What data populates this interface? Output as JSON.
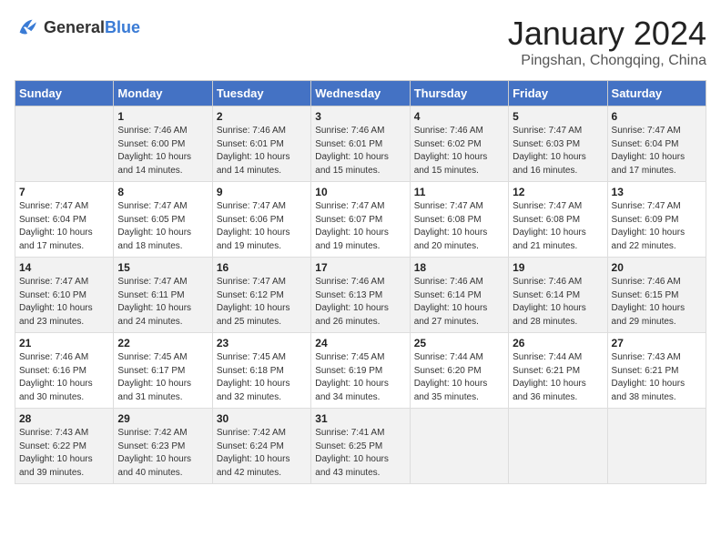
{
  "header": {
    "logo_general": "General",
    "logo_blue": "Blue",
    "month_title": "January 2024",
    "location": "Pingshan, Chongqing, China"
  },
  "days_of_week": [
    "Sunday",
    "Monday",
    "Tuesday",
    "Wednesday",
    "Thursday",
    "Friday",
    "Saturday"
  ],
  "weeks": [
    [
      {
        "day": "",
        "info": ""
      },
      {
        "day": "1",
        "info": "Sunrise: 7:46 AM\nSunset: 6:00 PM\nDaylight: 10 hours\nand 14 minutes."
      },
      {
        "day": "2",
        "info": "Sunrise: 7:46 AM\nSunset: 6:01 PM\nDaylight: 10 hours\nand 14 minutes."
      },
      {
        "day": "3",
        "info": "Sunrise: 7:46 AM\nSunset: 6:01 PM\nDaylight: 10 hours\nand 15 minutes."
      },
      {
        "day": "4",
        "info": "Sunrise: 7:46 AM\nSunset: 6:02 PM\nDaylight: 10 hours\nand 15 minutes."
      },
      {
        "day": "5",
        "info": "Sunrise: 7:47 AM\nSunset: 6:03 PM\nDaylight: 10 hours\nand 16 minutes."
      },
      {
        "day": "6",
        "info": "Sunrise: 7:47 AM\nSunset: 6:04 PM\nDaylight: 10 hours\nand 17 minutes."
      }
    ],
    [
      {
        "day": "7",
        "info": "Sunrise: 7:47 AM\nSunset: 6:04 PM\nDaylight: 10 hours\nand 17 minutes."
      },
      {
        "day": "8",
        "info": "Sunrise: 7:47 AM\nSunset: 6:05 PM\nDaylight: 10 hours\nand 18 minutes."
      },
      {
        "day": "9",
        "info": "Sunrise: 7:47 AM\nSunset: 6:06 PM\nDaylight: 10 hours\nand 19 minutes."
      },
      {
        "day": "10",
        "info": "Sunrise: 7:47 AM\nSunset: 6:07 PM\nDaylight: 10 hours\nand 19 minutes."
      },
      {
        "day": "11",
        "info": "Sunrise: 7:47 AM\nSunset: 6:08 PM\nDaylight: 10 hours\nand 20 minutes."
      },
      {
        "day": "12",
        "info": "Sunrise: 7:47 AM\nSunset: 6:08 PM\nDaylight: 10 hours\nand 21 minutes."
      },
      {
        "day": "13",
        "info": "Sunrise: 7:47 AM\nSunset: 6:09 PM\nDaylight: 10 hours\nand 22 minutes."
      }
    ],
    [
      {
        "day": "14",
        "info": "Sunrise: 7:47 AM\nSunset: 6:10 PM\nDaylight: 10 hours\nand 23 minutes."
      },
      {
        "day": "15",
        "info": "Sunrise: 7:47 AM\nSunset: 6:11 PM\nDaylight: 10 hours\nand 24 minutes."
      },
      {
        "day": "16",
        "info": "Sunrise: 7:47 AM\nSunset: 6:12 PM\nDaylight: 10 hours\nand 25 minutes."
      },
      {
        "day": "17",
        "info": "Sunrise: 7:46 AM\nSunset: 6:13 PM\nDaylight: 10 hours\nand 26 minutes."
      },
      {
        "day": "18",
        "info": "Sunrise: 7:46 AM\nSunset: 6:14 PM\nDaylight: 10 hours\nand 27 minutes."
      },
      {
        "day": "19",
        "info": "Sunrise: 7:46 AM\nSunset: 6:14 PM\nDaylight: 10 hours\nand 28 minutes."
      },
      {
        "day": "20",
        "info": "Sunrise: 7:46 AM\nSunset: 6:15 PM\nDaylight: 10 hours\nand 29 minutes."
      }
    ],
    [
      {
        "day": "21",
        "info": "Sunrise: 7:46 AM\nSunset: 6:16 PM\nDaylight: 10 hours\nand 30 minutes."
      },
      {
        "day": "22",
        "info": "Sunrise: 7:45 AM\nSunset: 6:17 PM\nDaylight: 10 hours\nand 31 minutes."
      },
      {
        "day": "23",
        "info": "Sunrise: 7:45 AM\nSunset: 6:18 PM\nDaylight: 10 hours\nand 32 minutes."
      },
      {
        "day": "24",
        "info": "Sunrise: 7:45 AM\nSunset: 6:19 PM\nDaylight: 10 hours\nand 34 minutes."
      },
      {
        "day": "25",
        "info": "Sunrise: 7:44 AM\nSunset: 6:20 PM\nDaylight: 10 hours\nand 35 minutes."
      },
      {
        "day": "26",
        "info": "Sunrise: 7:44 AM\nSunset: 6:21 PM\nDaylight: 10 hours\nand 36 minutes."
      },
      {
        "day": "27",
        "info": "Sunrise: 7:43 AM\nSunset: 6:21 PM\nDaylight: 10 hours\nand 38 minutes."
      }
    ],
    [
      {
        "day": "28",
        "info": "Sunrise: 7:43 AM\nSunset: 6:22 PM\nDaylight: 10 hours\nand 39 minutes."
      },
      {
        "day": "29",
        "info": "Sunrise: 7:42 AM\nSunset: 6:23 PM\nDaylight: 10 hours\nand 40 minutes."
      },
      {
        "day": "30",
        "info": "Sunrise: 7:42 AM\nSunset: 6:24 PM\nDaylight: 10 hours\nand 42 minutes."
      },
      {
        "day": "31",
        "info": "Sunrise: 7:41 AM\nSunset: 6:25 PM\nDaylight: 10 hours\nand 43 minutes."
      },
      {
        "day": "",
        "info": ""
      },
      {
        "day": "",
        "info": ""
      },
      {
        "day": "",
        "info": ""
      }
    ]
  ]
}
